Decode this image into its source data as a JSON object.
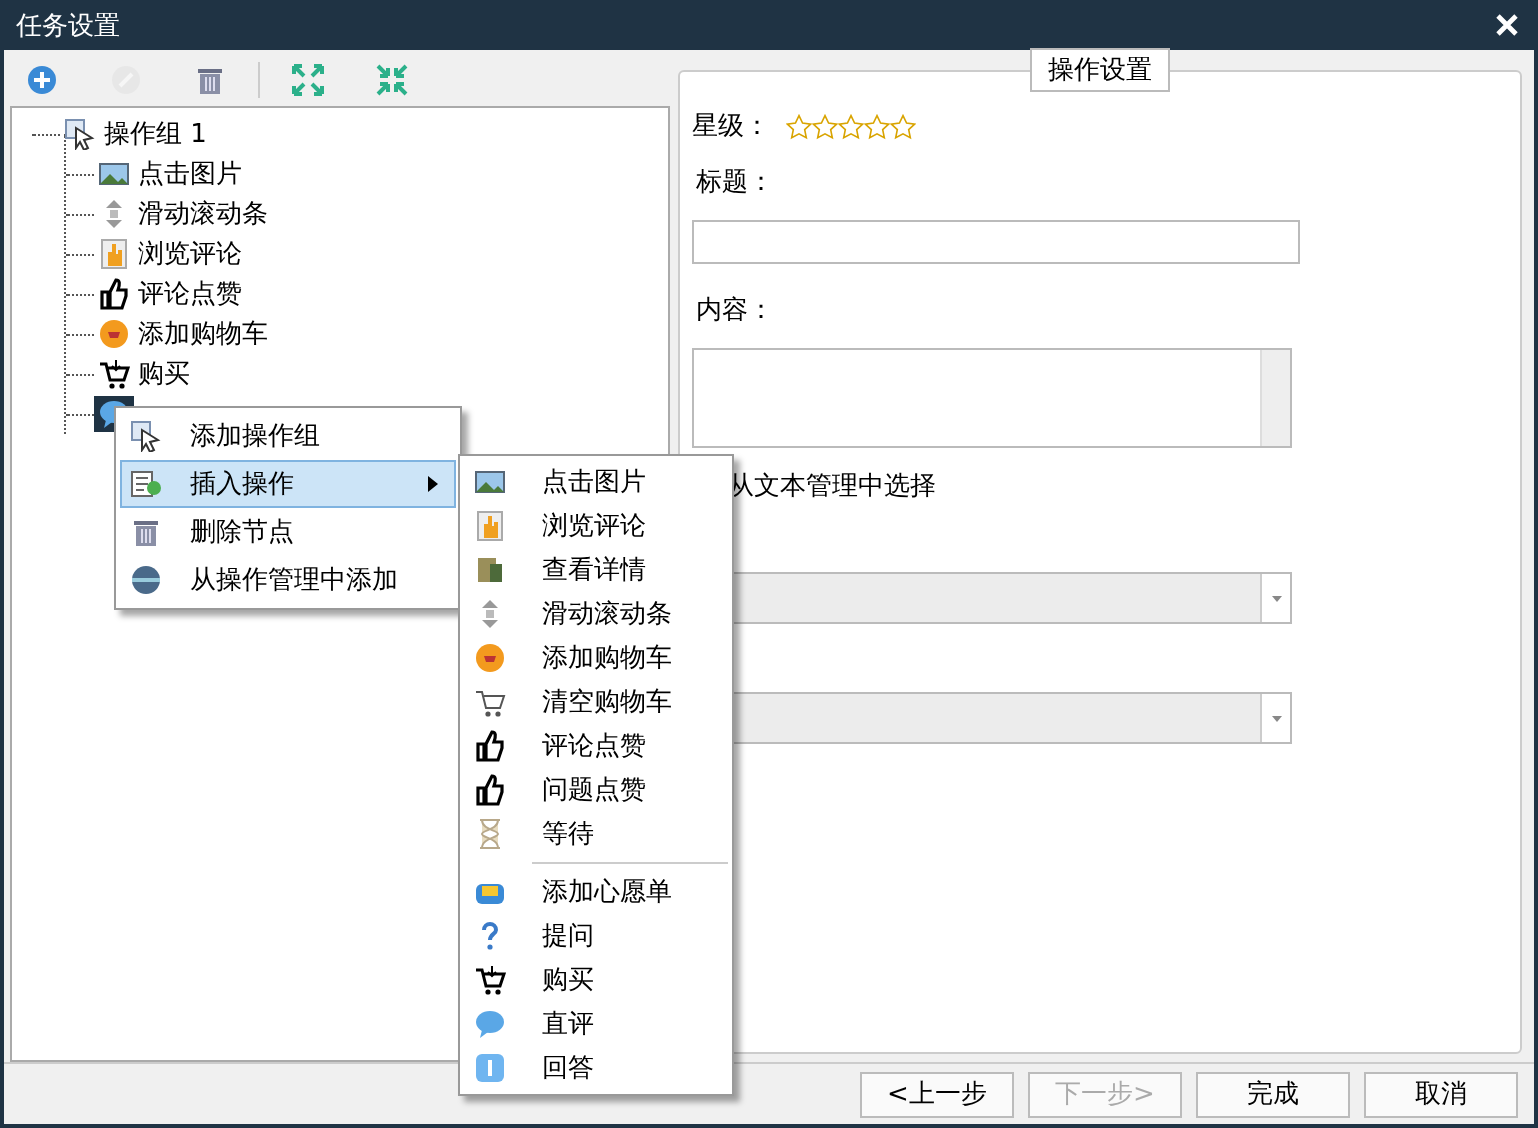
{
  "window": {
    "title": "任务设置"
  },
  "toolbar": [
    {
      "disabled": false
    },
    {
      "disabled": true
    },
    {
      "disabled": false
    },
    {
      "disabled": false
    },
    {
      "disabled": false
    }
  ],
  "tree": {
    "label": "操作组 1",
    "children": [
      {
        "label": "点击图片",
        "selected": false
      },
      {
        "label": "滑动滚动条",
        "selected": false
      },
      {
        "label": "浏览评论",
        "selected": false
      },
      {
        "label": "评论点赞",
        "selected": false
      },
      {
        "label": "添加购物车",
        "selected": false
      },
      {
        "label": "购买",
        "selected": false
      },
      {
        "selected": true
      }
    ]
  },
  "context_menu": [
    {
      "label": "添加操作组",
      "selected": false,
      "has_submenu": false
    },
    {
      "label": "插入操作",
      "selected": true,
      "has_submenu": true
    },
    {
      "label": "删除节点",
      "selected": false,
      "has_submenu": false
    },
    {
      "label": "从操作管理中添加",
      "selected": false,
      "has_submenu": false
    }
  ],
  "submenu": [
    [
      "点击图片",
      "浏览评论",
      "查看详情",
      "滑动滚动条",
      "添加购物车",
      "清空购物车",
      "评论点赞",
      "问题点赞",
      "等待"
    ],
    [
      "添加心愿单",
      "提问",
      "购买",
      "直评",
      "回答"
    ]
  ],
  "settings": {
    "title": "操作设置",
    "stars_label": "星级：",
    "stars": 0,
    "title_label": "标题：",
    "content_label": "内容：",
    "text_manager_label": "从文本管理中选择",
    "dropdowns": [
      {
        "disabled": true
      },
      {
        "disabled": true
      }
    ]
  },
  "buttons": [
    {
      "label": "<上一步",
      "disabled": false
    },
    {
      "label": "下一步>",
      "disabled": true
    },
    {
      "label": "完成",
      "disabled": false
    },
    {
      "label": "取消",
      "disabled": false
    }
  ]
}
